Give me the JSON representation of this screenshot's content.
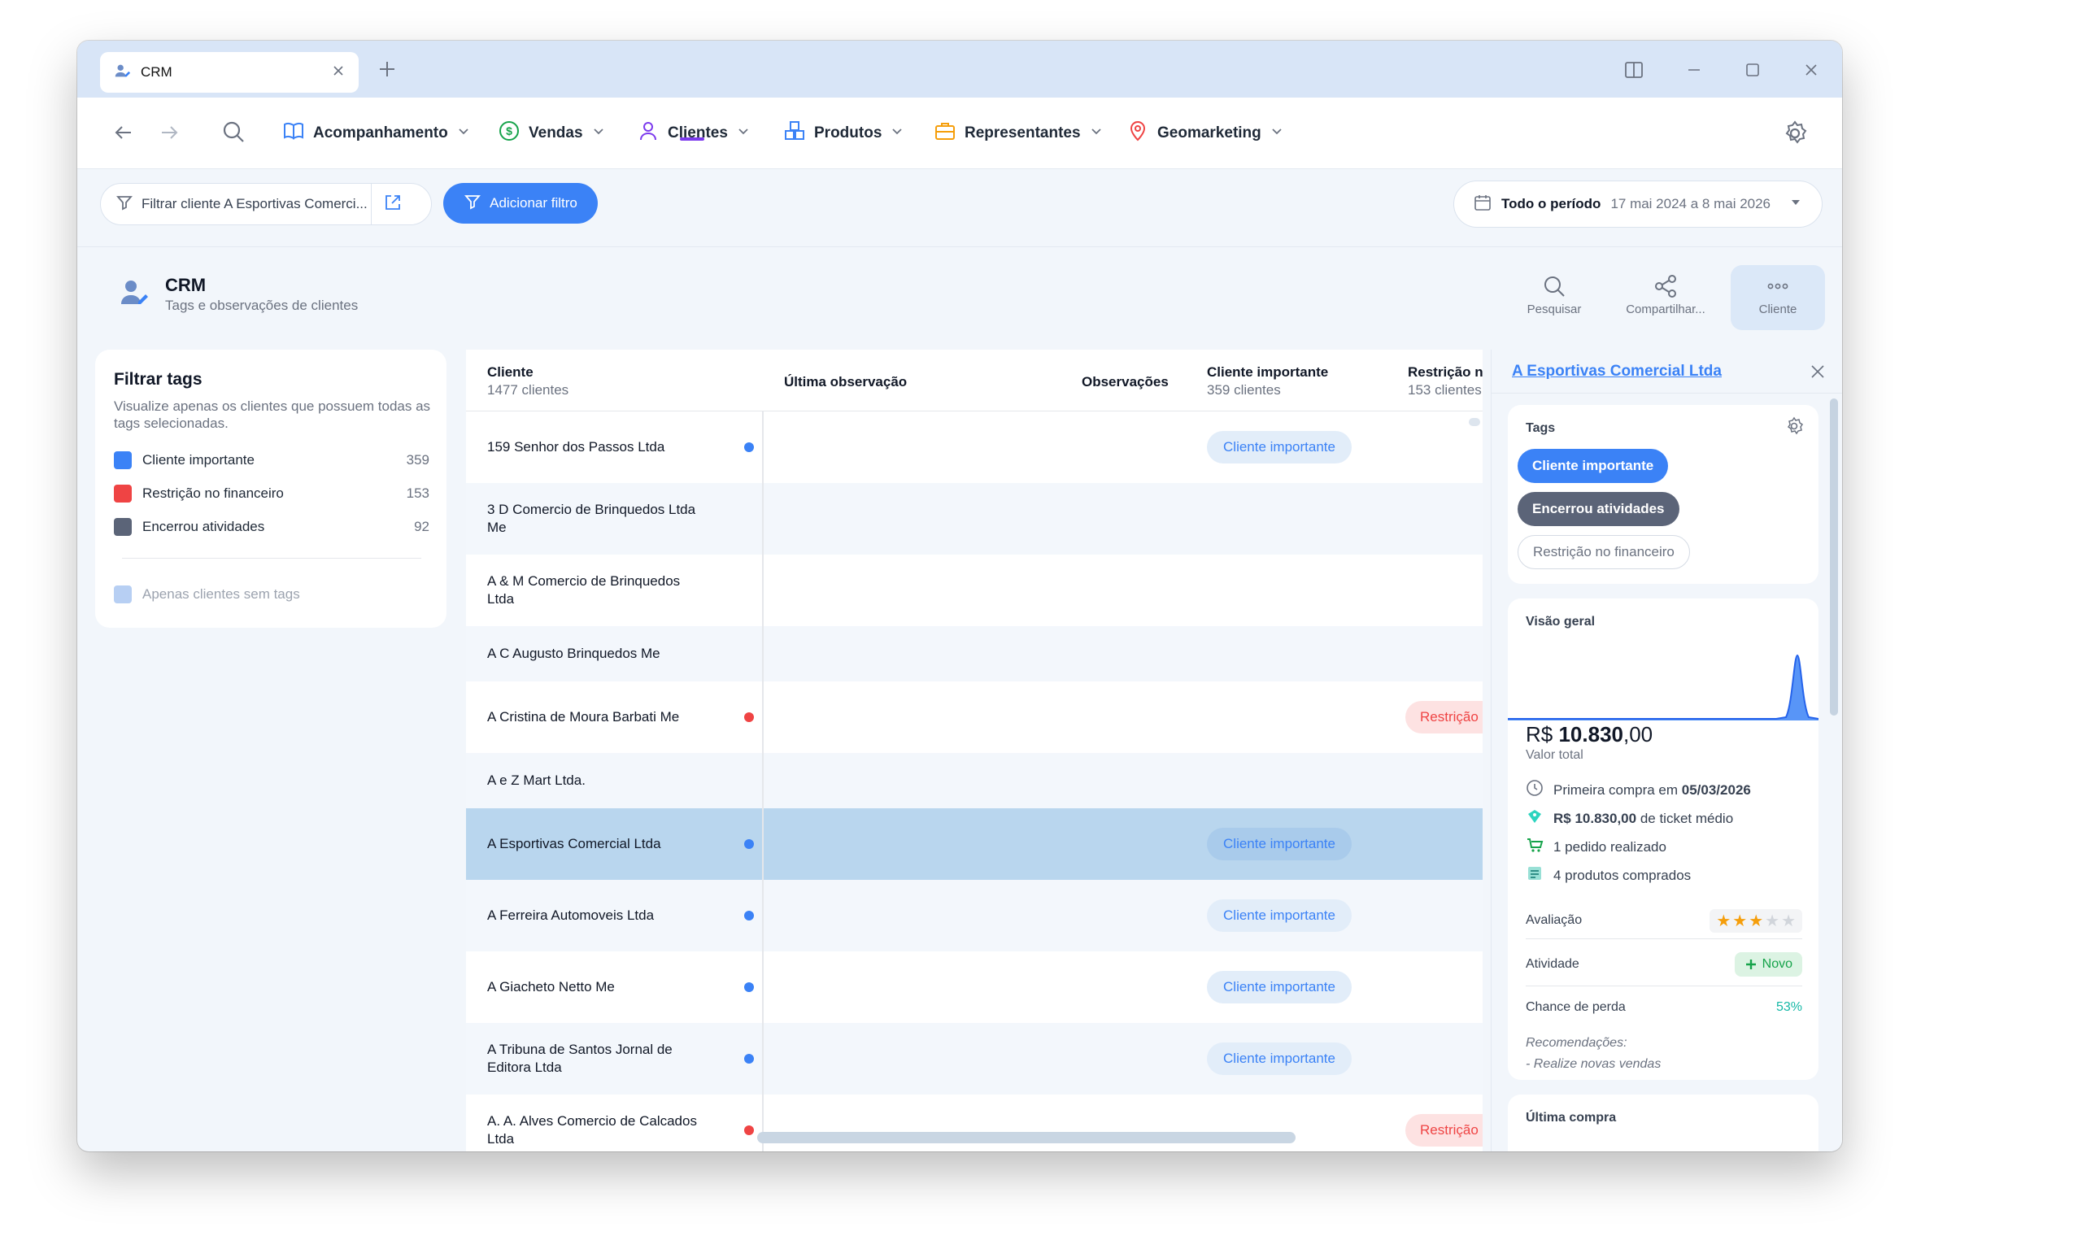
{
  "tab": {
    "title": "CRM"
  },
  "nav": {
    "items": [
      {
        "label": "Acompanhamento"
      },
      {
        "label": "Vendas"
      },
      {
        "label": "Clientes"
      },
      {
        "label": "Produtos"
      },
      {
        "label": "Representantes"
      },
      {
        "label": "Geomarketing"
      }
    ],
    "active": "Clientes"
  },
  "filter": {
    "chip_label": "Filtrar cliente A Esportivas Comerci...",
    "add_label": "Adicionar filtro",
    "period_label": "Todo o período",
    "period_range": "17 mai 2024 a 8 mai 2026"
  },
  "header": {
    "title": "CRM",
    "subtitle": "Tags e observações de clientes",
    "actions": [
      {
        "label": "Pesquisar"
      },
      {
        "label": "Compartilhar..."
      },
      {
        "label": "Cliente"
      }
    ]
  },
  "tags_filter": {
    "title": "Filtrar tags",
    "description": "Visualize apenas os clientes que possuem todas as tags selecionadas.",
    "tags": [
      {
        "label": "Cliente importante",
        "count": "359",
        "color": "#3b82f6"
      },
      {
        "label": "Restrição no financeiro",
        "count": "153",
        "color": "#ef4444"
      },
      {
        "label": "Encerrou atividades",
        "count": "92",
        "color": "#5b6478"
      }
    ],
    "no_tags_label": "Apenas clientes sem tags"
  },
  "table": {
    "columns": [
      {
        "label": "Cliente",
        "sub": "1477 clientes"
      },
      {
        "label": "Última observação",
        "sub": ""
      },
      {
        "label": "Observações",
        "sub": ""
      },
      {
        "label": "Cliente importante",
        "sub": "359 clientes"
      },
      {
        "label": "Restrição n",
        "sub": "153 clientes"
      }
    ],
    "chip_important": "Cliente importante",
    "chip_restriction": "Restrição",
    "rows": [
      {
        "name": "159 Senhor dos Passos Ltda",
        "dot": "blue",
        "important": true,
        "restriction": false
      },
      {
        "name": "3 D Comercio de Brinquedos Ltda Me",
        "dot": "",
        "important": false,
        "restriction": false
      },
      {
        "name": "A & M Comercio de Brinquedos Ltda",
        "dot": "",
        "important": false,
        "restriction": false
      },
      {
        "name": "A C Augusto Brinquedos Me",
        "dot": "",
        "important": false,
        "restriction": false
      },
      {
        "name": "A Cristina de Moura Barbati Me",
        "dot": "red",
        "important": false,
        "restriction": true
      },
      {
        "name": "A e Z  Mart Ltda.",
        "dot": "",
        "important": false,
        "restriction": false
      },
      {
        "name": "A Esportivas Comercial Ltda",
        "dot": "blue",
        "important": true,
        "restriction": false,
        "selected": true
      },
      {
        "name": "A Ferreira Automoveis Ltda",
        "dot": "blue",
        "important": true,
        "restriction": false
      },
      {
        "name": "A Giacheto Netto Me",
        "dot": "blue",
        "important": true,
        "restriction": false
      },
      {
        "name": "A Tribuna de Santos Jornal de Editora Ltda",
        "dot": "blue",
        "important": true,
        "restriction": false
      },
      {
        "name": "A. A. Alves Comercio de Calcados Ltda",
        "dot": "red",
        "important": false,
        "restriction": true
      }
    ]
  },
  "panel": {
    "client_name": "A Esportivas Comercial Ltda",
    "tags_title": "Tags",
    "tags": [
      {
        "label": "Cliente importante",
        "style": "blue"
      },
      {
        "label": "Encerrou atividades",
        "style": "gray"
      },
      {
        "label": "Restrição no financeiro",
        "style": "outline"
      }
    ],
    "overview_title": "Visão geral",
    "total_prefix": "R$ ",
    "total_main": "10.830",
    "total_cents": ",00",
    "total_label": "Valor total",
    "stats": [
      {
        "text": "Primeira compra em ",
        "bold": "05/03/2026",
        "icon": "clock-icon"
      },
      {
        "text": "R$ 10.830,00",
        "bold": "",
        "suffix": " de ticket médio",
        "icon": "ticket-icon"
      },
      {
        "text": "1 pedido realizado",
        "bold": "",
        "icon": "cart-icon"
      },
      {
        "text": "4 produtos comprados",
        "bold": "",
        "icon": "box-icon"
      }
    ],
    "rating_label": "Avaliação",
    "rating_value": 3,
    "rating_max": 5,
    "activity_label": "Atividade",
    "activity_value": "Novo",
    "loss_label": "Chance de perda",
    "loss_value": "53%",
    "recommendations_label": "Recomendações:",
    "recommendation": "- Realize novas vendas",
    "last_purchase_title": "Última compra"
  },
  "colors": {
    "accent": "#3b82f6",
    "danger": "#ef4444",
    "selected_row": "#b9d6ee",
    "nav_active": "#7c3aed"
  }
}
